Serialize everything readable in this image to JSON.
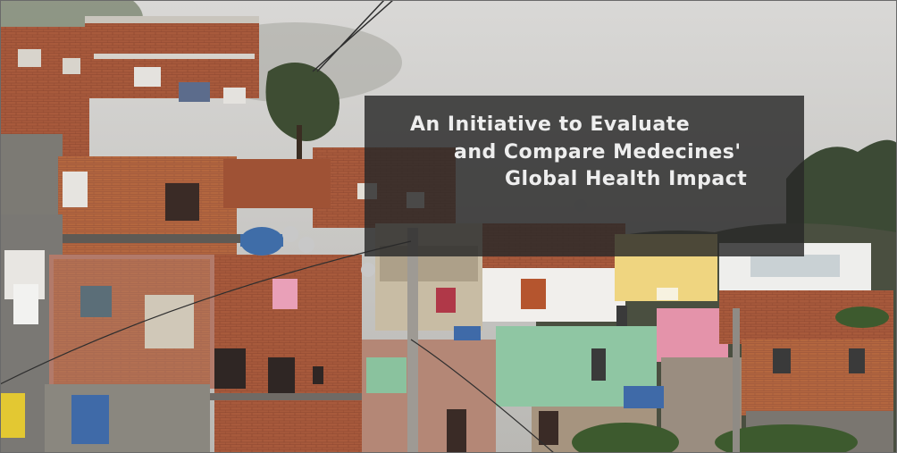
{
  "caption": {
    "line1": "An Initiative to Evaluate",
    "line2": "and Compare Medecines'",
    "line3": "Global Health Impact"
  }
}
